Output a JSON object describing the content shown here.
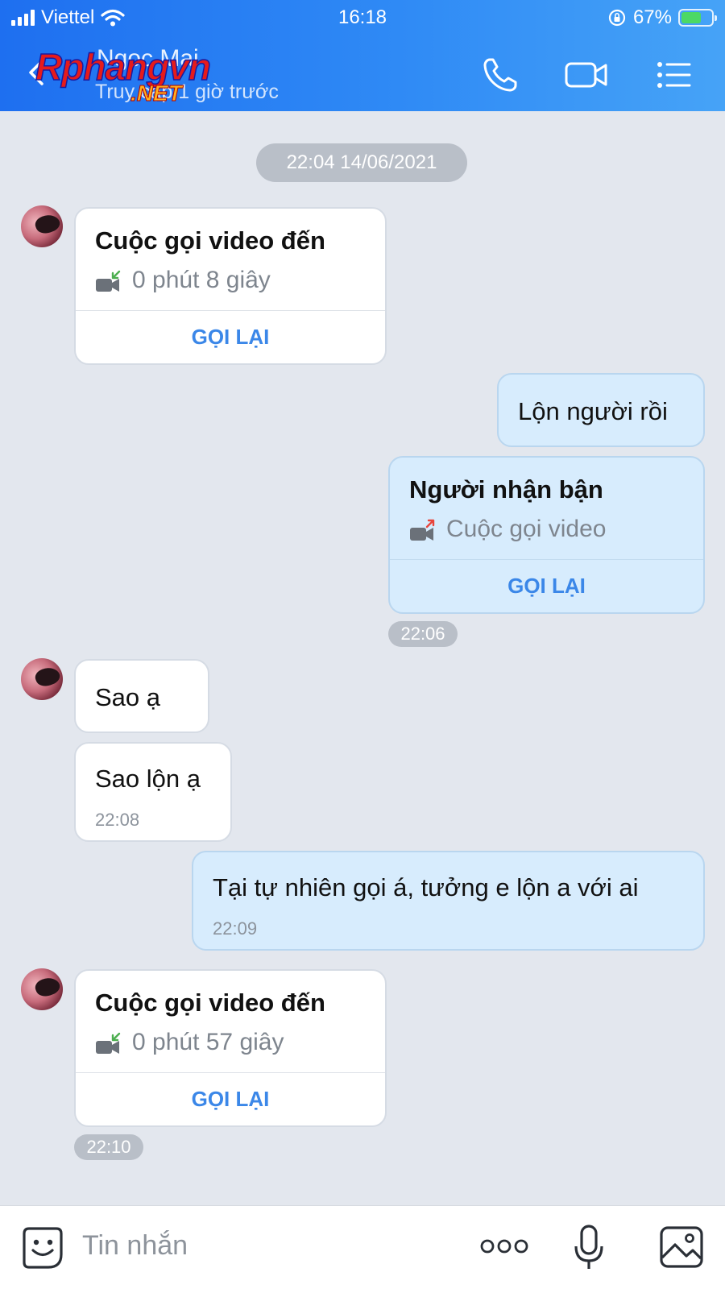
{
  "status_bar": {
    "carrier": "Viettel",
    "time": "16:18",
    "battery": "67%",
    "battery_level": 0.67
  },
  "header": {
    "contact_name": "Ngoc Mai",
    "last_seen": "Truy cập 1 giờ trước",
    "watermark": {
      "brand": "Rphangvn",
      "suffix": ".NET"
    },
    "icons": [
      "back-icon",
      "phone-icon",
      "video-call-icon",
      "menu-list-icon"
    ]
  },
  "chat": {
    "date_separator": "22:04 14/06/2021",
    "messages": [
      {
        "side": "received",
        "type": "call",
        "title": "Cuộc gọi video đến",
        "detail": "0 phút 8 giây",
        "action": "GỌI LẠI",
        "icon": "incoming-video-call-icon"
      },
      {
        "side": "sent",
        "type": "text",
        "text": "Lộn người rồi"
      },
      {
        "side": "sent",
        "type": "call",
        "title": "Người nhận bận",
        "detail": "Cuộc gọi video",
        "action": "GỌI LẠI",
        "time": "22:06",
        "icon": "outgoing-video-call-icon"
      },
      {
        "side": "received",
        "type": "text",
        "text": "Sao ạ"
      },
      {
        "side": "received",
        "type": "text",
        "text": "Sao lộn ạ",
        "time": "22:08"
      },
      {
        "side": "sent",
        "type": "text",
        "text": "Tại tự nhiên gọi á, tưởng e lộn a với ai",
        "time": "22:09"
      },
      {
        "side": "received",
        "type": "call",
        "title": "Cuộc gọi video đến",
        "detail": "0 phút 57 giây",
        "action": "GỌI LẠI",
        "time": "22:10",
        "icon": "incoming-video-call-icon"
      }
    ]
  },
  "composer": {
    "placeholder": "Tin nhắn",
    "icons": [
      "emoji-sticker-icon",
      "more-options-icon",
      "microphone-icon",
      "image-gallery-icon"
    ]
  },
  "colors": {
    "header_gradient_start": "#1e6ff0",
    "header_gradient_end": "#46a3f7",
    "chat_background": "#e3e7ee",
    "sent_bubble": "#d7ecfd",
    "received_bubble": "#ffffff",
    "recall_button": "#3b87e8",
    "incoming_arrow": "#4cae4f",
    "outgoing_arrow": "#e8453c"
  }
}
